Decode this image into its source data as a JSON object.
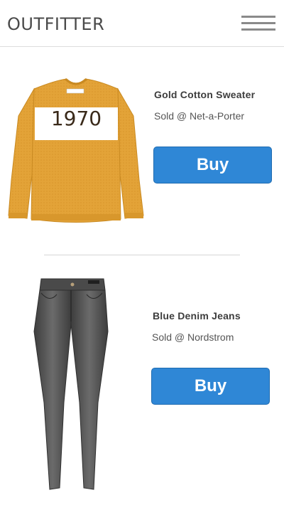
{
  "header": {
    "logo": "OUTFITTER",
    "menu_icon": "hamburger-menu-icon"
  },
  "products": [
    {
      "name": "Gold Cotton Sweater",
      "seller": "Sold @ Net-a-Porter",
      "buy_label": "Buy",
      "image": {
        "icon": "sweater-image",
        "print": "1970",
        "color": "#e3a338"
      }
    },
    {
      "name": "Blue Denim Jeans",
      "seller": "Sold @ Nordstrom",
      "buy_label": "Buy",
      "image": {
        "icon": "jeans-image",
        "color": "#4a4a4a"
      }
    }
  ],
  "colors": {
    "accent": "#2f87d6",
    "text": "#333333",
    "divider": "#d6d6d6"
  }
}
